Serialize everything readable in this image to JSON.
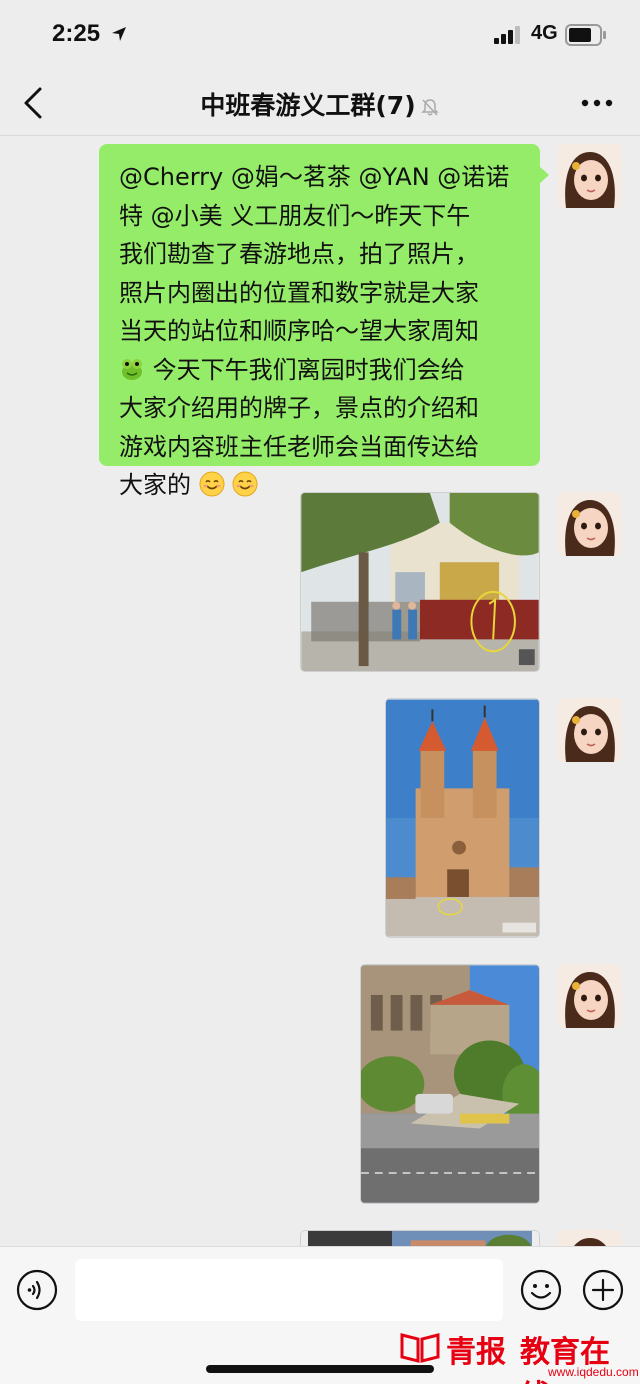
{
  "status_bar": {
    "time": "2:25",
    "network": "4G"
  },
  "header": {
    "title": "中班春游义工群(7)",
    "muted": true
  },
  "messages": [
    {
      "type": "text",
      "lines": [
        "@Cherry @娟～茗茶 @YAN @诺诺",
        "特 @小美 义工朋友们～昨天下午",
        "我们勘查了春游地点，拍了照片，",
        "照片内圈出的位置和数字就是大家",
        "当天的站位和顺序哈～望大家周知"
      ],
      "line6": "今天下午我们离园时我们会给",
      "lines_after": [
        "大家介绍用的牌子，景点的介绍和",
        "游戏内容班主任老师会当面传达给"
      ],
      "last_line": "大家的"
    },
    {
      "type": "image",
      "description_icon": "photo-kindergarten-gate"
    },
    {
      "type": "image",
      "description_icon": "photo-church"
    },
    {
      "type": "image",
      "description_icon": "photo-building-street"
    },
    {
      "type": "image",
      "description_icon": "photo-partial"
    }
  ],
  "watermark": {
    "brand": "青报",
    "edu": "教育在线",
    "url": "www.iqdedu.com"
  },
  "colors": {
    "bubble": "#95ec69",
    "background": "#ededed",
    "watermark": "#e60012"
  }
}
